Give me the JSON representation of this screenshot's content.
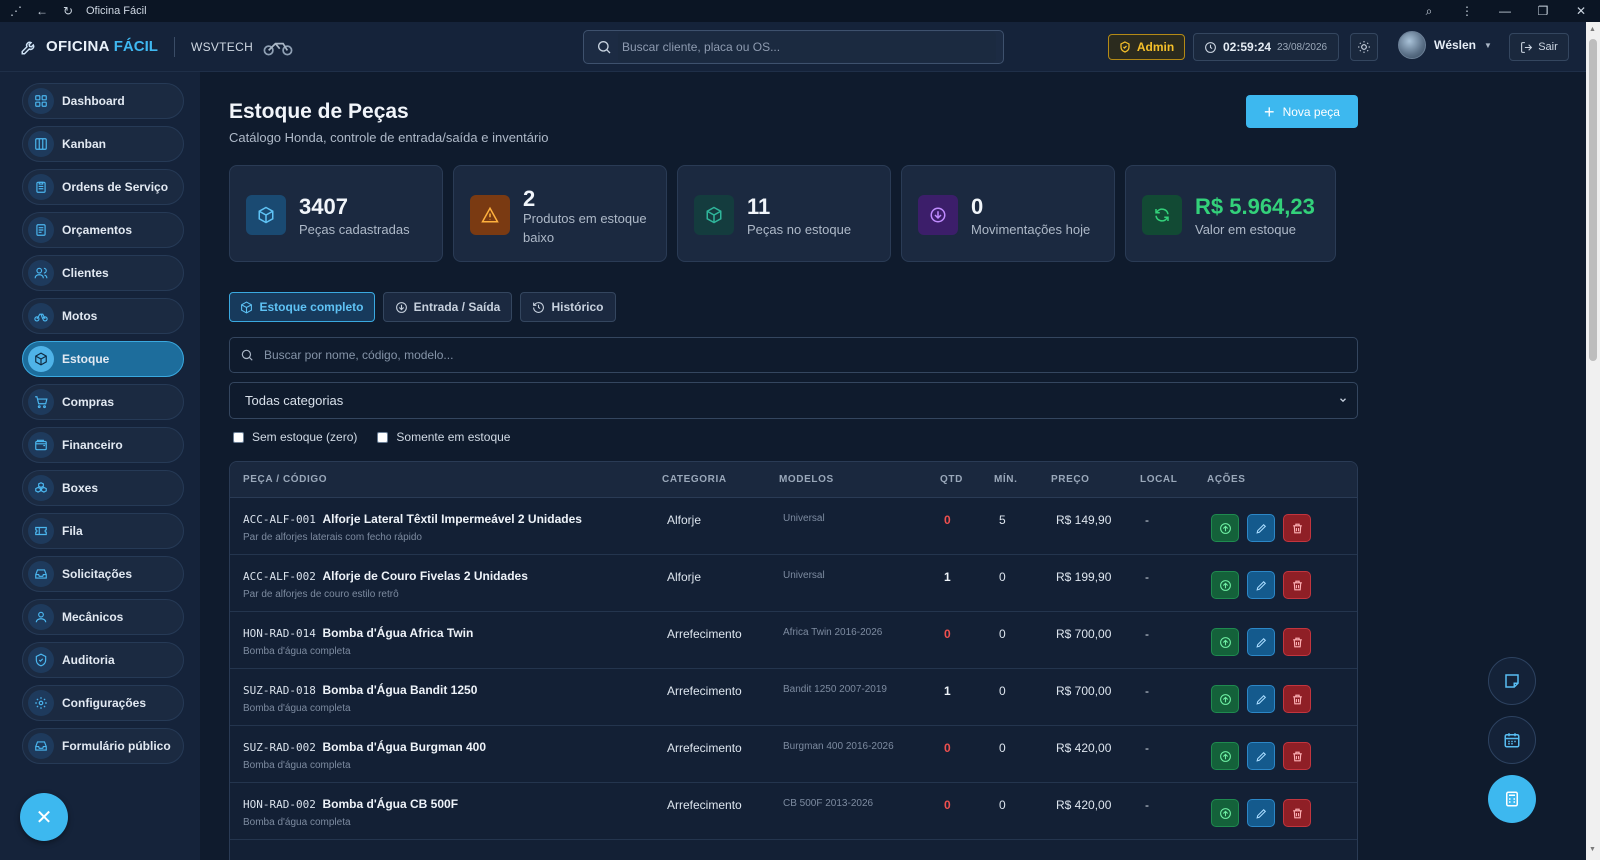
{
  "window": {
    "title": "Oficina Fácil"
  },
  "brand": {
    "name_part1": "OFICINA",
    "name_part2": "FÁCIL",
    "company": "WSVTECH"
  },
  "header": {
    "search_placeholder": "Buscar cliente, placa ou OS...",
    "role_badge": "Admin",
    "time": "02:59:24",
    "date": "23/08/2026",
    "user_name": "Wéslen",
    "logout_label": "Sair"
  },
  "sidebar": {
    "items": [
      {
        "label": "Dashboard",
        "icon": "dashboard-icon"
      },
      {
        "label": "Kanban",
        "icon": "kanban-icon"
      },
      {
        "label": "Ordens de Serviço",
        "icon": "clipboard-icon"
      },
      {
        "label": "Orçamentos",
        "icon": "document-icon"
      },
      {
        "label": "Clientes",
        "icon": "users-icon"
      },
      {
        "label": "Motos",
        "icon": "bike-icon"
      },
      {
        "label": "Estoque",
        "icon": "box-icon"
      },
      {
        "label": "Compras",
        "icon": "cart-icon"
      },
      {
        "label": "Financeiro",
        "icon": "wallet-icon"
      },
      {
        "label": "Boxes",
        "icon": "boxes-icon"
      },
      {
        "label": "Fila",
        "icon": "ticket-icon"
      },
      {
        "label": "Solicitações",
        "icon": "inbox-icon"
      },
      {
        "label": "Mecânicos",
        "icon": "user-icon"
      },
      {
        "label": "Auditoria",
        "icon": "shield-icon"
      },
      {
        "label": "Configurações",
        "icon": "gear-icon"
      },
      {
        "label": "Formulário público",
        "icon": "inbox-icon"
      }
    ],
    "active": "Estoque"
  },
  "page": {
    "title": "Estoque de Peças",
    "subtitle": "Catálogo Honda, controle de entrada/saída e inventário",
    "new_button": "Nova peça"
  },
  "stats": [
    {
      "value": "3407",
      "label": "Peças cadastradas",
      "icon": "box-icon",
      "color": "#1a4a72"
    },
    {
      "value": "2",
      "label": "Produtos em estoque baixo",
      "icon": "warning-icon",
      "color": "#7a3a12"
    },
    {
      "value": "11",
      "label": "Peças no estoque",
      "icon": "box-icon",
      "color": "#143c3e"
    },
    {
      "value": "0",
      "label": "Movimentações hoje",
      "icon": "arrow-down-circle-icon",
      "color": "#3c1e6a"
    },
    {
      "value": "R$ 5.964,23",
      "label": "Valor em estoque",
      "icon": "refresh-icon",
      "color": "#124a34"
    }
  ],
  "tabs": [
    {
      "label": "Estoque completo",
      "icon": "box-icon"
    },
    {
      "label": "Entrada / Saída",
      "icon": "arrow-down-circle-icon"
    },
    {
      "label": "Histórico",
      "icon": "history-icon"
    }
  ],
  "filters": {
    "search_placeholder": "Buscar por nome, código, modelo...",
    "category_selected": "Todas categorias",
    "checkbox_zero": "Sem estoque (zero)",
    "checkbox_instock": "Somente em estoque"
  },
  "table": {
    "headers": [
      "PEÇA / CÓDIGO",
      "CATEGORIA",
      "MODELOS",
      "QTD",
      "MÍN.",
      "PREÇO",
      "LOCAL",
      "AÇÕES"
    ],
    "rows": [
      {
        "code": "ACC-ALF-001",
        "name": "Alforje Lateral Têxtil Impermeável 2 Unidades",
        "desc": "Par de alforjes laterais com fecho rápido",
        "category": "Alforje",
        "models": "Universal",
        "qty": "0",
        "min": "5",
        "price": "R$ 149,90",
        "local": "-"
      },
      {
        "code": "ACC-ALF-002",
        "name": "Alforje de Couro Fivelas 2 Unidades",
        "desc": "Par de alforjes de couro estilo retrô",
        "category": "Alforje",
        "models": "Universal",
        "qty": "1",
        "min": "0",
        "price": "R$ 199,90",
        "local": "-"
      },
      {
        "code": "HON-RAD-014",
        "name": "Bomba d'Água Africa Twin",
        "desc": "Bomba d'água completa",
        "category": "Arrefecimento",
        "models": "Africa Twin 2016-2026",
        "qty": "0",
        "min": "0",
        "price": "R$ 700,00",
        "local": "-"
      },
      {
        "code": "SUZ-RAD-018",
        "name": "Bomba d'Água Bandit 1250",
        "desc": "Bomba d'água completa",
        "category": "Arrefecimento",
        "models": "Bandit 1250 2007-2019",
        "qty": "1",
        "min": "0",
        "price": "R$ 700,00",
        "local": "-"
      },
      {
        "code": "SUZ-RAD-002",
        "name": "Bomba d'Água Burgman 400",
        "desc": "Bomba d'água completa",
        "category": "Arrefecimento",
        "models": "Burgman 400 2016-2026",
        "qty": "0",
        "min": "0",
        "price": "R$ 420,00",
        "local": "-"
      },
      {
        "code": "HON-RAD-002",
        "name": "Bomba d'Água CB 500F",
        "desc": "Bomba d'água completa",
        "category": "Arrefecimento",
        "models": "CB 500F 2013-2026",
        "qty": "0",
        "min": "0",
        "price": "R$ 420,00",
        "local": "-"
      }
    ]
  },
  "colors": {
    "accent": "#3db8ef",
    "danger": "#f0504f",
    "success": "#33d17a",
    "warning": "#f5c02a"
  }
}
